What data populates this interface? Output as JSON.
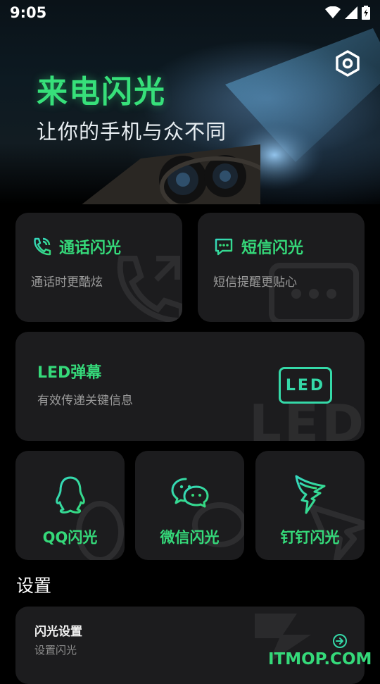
{
  "status_bar": {
    "time": "9:05"
  },
  "banner": {
    "title": "来电闪光",
    "subtitle": "让你的手机与众不同"
  },
  "cards": {
    "call": {
      "title": "通话闪光",
      "desc": "通话时更酷炫"
    },
    "sms": {
      "title": "短信闪光",
      "desc": "短信提醒更贴心"
    },
    "led": {
      "title": "LED弹幕",
      "desc": "有效传递关键信息",
      "badge": "LED"
    },
    "qq": {
      "title": "QQ闪光"
    },
    "wechat": {
      "title": "微信闪光"
    },
    "dingtalk": {
      "title": "钉钉闪光"
    }
  },
  "settings_section": {
    "title": "设置",
    "item": {
      "title": "闪光设置",
      "subtitle": "设置闪光"
    }
  },
  "watermark": "ITMOP.COM",
  "colors": {
    "accent": "#35d97a",
    "card_bg": "#1c1c1e",
    "background": "#000000"
  },
  "icons": [
    "settings-hex-icon",
    "phone-call-icon",
    "chat-bubble-icon",
    "led-icon",
    "qq-penguin-icon",
    "wechat-icon",
    "dingtalk-icon",
    "arrow-right-circle-icon",
    "wifi-icon",
    "signal-icon",
    "battery-icon"
  ]
}
